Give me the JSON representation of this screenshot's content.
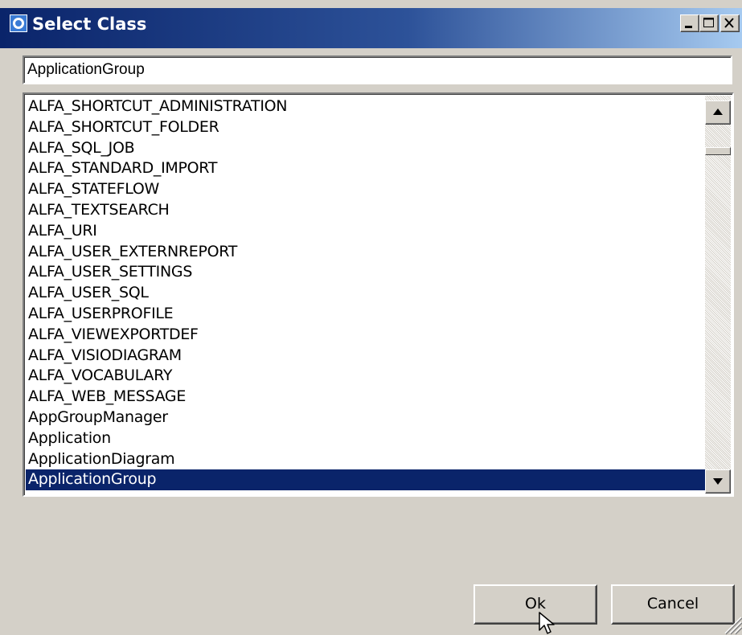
{
  "window": {
    "title": "Select Class"
  },
  "search": {
    "value": "ApplicationGroup"
  },
  "class_list": {
    "items": [
      "ALFA_SHORTCUT_ADMINISTRATION",
      "ALFA_SHORTCUT_FOLDER",
      "ALFA_SQL_JOB",
      "ALFA_STANDARD_IMPORT",
      "ALFA_STATEFLOW",
      "ALFA_TEXTSEARCH",
      "ALFA_URI",
      "ALFA_USER_EXTERNREPORT",
      "ALFA_USER_SETTINGS",
      "ALFA_USER_SQL",
      "ALFA_USERPROFILE",
      "ALFA_VIEWEXPORTDEF",
      "ALFA_VISIODIAGRAM",
      "ALFA_VOCABULARY",
      "ALFA_WEB_MESSAGE",
      "AppGroupManager",
      "Application",
      "ApplicationDiagram",
      "ApplicationGroup"
    ],
    "selected_index": 18
  },
  "buttons": {
    "ok_label": "Ok",
    "cancel_label": "Cancel"
  },
  "icons": {
    "app": "app-icon",
    "minimize": "minimize-icon",
    "maximize": "maximize-icon",
    "close": "close-icon",
    "scroll_up": "arrow-up-icon",
    "scroll_down": "arrow-down-icon",
    "grip": "resize-grip-icon",
    "cursor": "mouse-cursor-icon"
  },
  "colors": {
    "title_bar_start": "#0a246a",
    "title_bar_end": "#a6caf0",
    "selection": "#0a246a",
    "face": "#d4d0c8"
  }
}
